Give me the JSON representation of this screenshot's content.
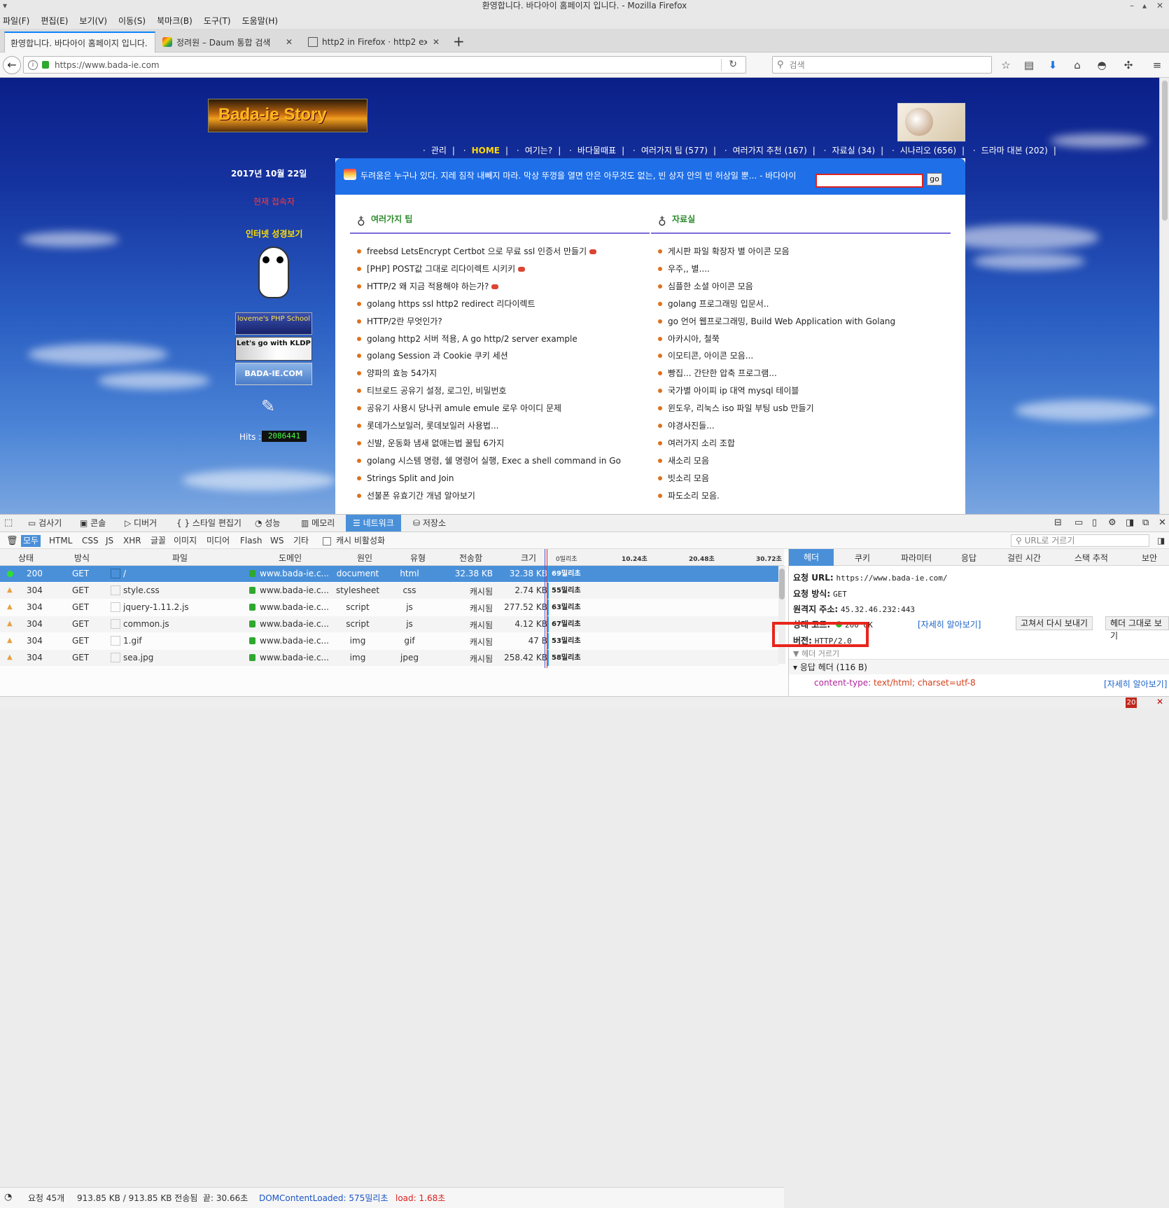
{
  "window": {
    "title": "환영합니다. 바다아이 홈페이지 입니다. - Mozilla Firefox"
  },
  "menu": [
    "파일(F)",
    "편집(E)",
    "보기(V)",
    "이동(S)",
    "북마크(B)",
    "도구(T)",
    "도움말(H)"
  ],
  "tabs": [
    {
      "label": "환영합니다. 바다아이 홈페이지 입니다.",
      "active": true
    },
    {
      "label": "정려원 – Daum 통합 검색",
      "active": false
    },
    {
      "label": "http2 in Firefox · http2 explained",
      "active": false
    }
  ],
  "nav": {
    "url": "https://www.bada-ie.com",
    "search_placeholder": "검색"
  },
  "site": {
    "logo_text": "Bada-ie Story",
    "links": [
      "관리",
      "HOME",
      "여기는?",
      "바다물때표",
      "여러가지 팁 (577)",
      "여러가지 추천 (167)",
      "자료실 (34)",
      "시나리오 (656)",
      "드라마 대본 (202)"
    ],
    "date": "2017년 10월 22일",
    "visitors_label": "현재 접속자",
    "bible_label": "인터넷 성경보기",
    "badges": [
      "loveme's PHP School",
      "Let's go with KLDP",
      "BADA-IE.COM"
    ],
    "hits_label": "Hits :",
    "hits_value": "2086441",
    "quote": "두려움은 누구나 있다. 지레 짐작 내빼지 마라. 막상 뚜껑을 열면 안은 아무것도 없는, 빈 상자 안의 빈 허상일 뿐... - 바다아이",
    "search_button": "go",
    "section1_title": "여러가지 팁",
    "section2_title": "자료실",
    "tips": [
      {
        "text": "freebsd LetsEncrypt Certbot 으로 무료 ssl 인증서 만들기",
        "new": true
      },
      {
        "text": "[PHP] POST값 그대로 리다이렉트 시키키",
        "new": true
      },
      {
        "text": "HTTP/2 왜 지금 적용해야 하는가?",
        "new": true
      },
      {
        "text": "golang https ssl http2 redirect 리다이렉트",
        "new": false
      },
      {
        "text": "HTTP/2란 무엇인가?",
        "new": false
      },
      {
        "text": "golang http2 서버 적용, A go http/2 server example",
        "new": false
      },
      {
        "text": "golang Session 과 Cookie 쿠키 세션",
        "new": false
      },
      {
        "text": "양파의 효능 54가지",
        "new": false
      },
      {
        "text": "티브로드 공유기 설정, 로그인, 비밀번호",
        "new": false
      },
      {
        "text": "공유기 사용시 당나귀 amule emule 로우 아이디 문제",
        "new": false
      },
      {
        "text": "롯데가스보일러, 롯데보일러 사용법...",
        "new": false
      },
      {
        "text": "신발, 운동화 냄새 없애는법 꿀팁 6가지",
        "new": false
      },
      {
        "text": "golang 시스템 명령, 쉘 명령어 실행, Exec a shell command in Go",
        "new": false
      },
      {
        "text": "Strings Split and Join",
        "new": false
      },
      {
        "text": "선불폰 유효기간 개념 알아보기",
        "new": false
      }
    ],
    "files": [
      "게시판 파일 확장자 별 아이콘 모음",
      "우주,, 별....",
      "심플한 소셜 아이콘 모음",
      "golang 프로그래밍 입문서..",
      "go 언어 웹프로그래밍, Build Web Application with Golang",
      "아카시아, 철쭉",
      "이모티콘, 아이콘 모음...",
      "빵집... 간단한 압축 프로그램...",
      "국가별 아이피 ip 대역 mysql 테이블",
      "윈도우, 리눅스 iso 파일 부팅 usb 만들기",
      "야경사진들...",
      "여러가지 소리 조합",
      "새소리 모음",
      "빗소리 모음",
      "파도소리 모음."
    ]
  },
  "devtools": {
    "tools": [
      "검사기",
      "콘솔",
      "디버거",
      "스타일 편집기",
      "성능",
      "메모리",
      "네트워크",
      "저장소"
    ],
    "filters": [
      "모두",
      "HTML",
      "CSS",
      "JS",
      "XHR",
      "글꼴",
      "이미지",
      "미디어",
      "Flash",
      "WS",
      "기타"
    ],
    "cache_label": "캐시 비활성화",
    "url_filter_placeholder": "URL로 거르기",
    "columns": [
      "상태",
      "방식",
      "파일",
      "도메인",
      "원인",
      "유형",
      "전송함",
      "크기"
    ],
    "timeline_ticks": [
      "0밀리초",
      "10.24초",
      "20.48초",
      "30.72초"
    ],
    "requests": [
      {
        "status": "200",
        "method": "GET",
        "file": "/",
        "domain": "www.bada-ie.c...",
        "cause": "document",
        "type": "html",
        "transferred": "32.38 KB",
        "size": "32.38 KB",
        "time": "69밀리초",
        "selected": true
      },
      {
        "status": "304",
        "method": "GET",
        "file": "style.css",
        "domain": "www.bada-ie.c...",
        "cause": "stylesheet",
        "type": "css",
        "transferred": "캐시됨",
        "size": "2.74 KB",
        "time": "55밀리초"
      },
      {
        "status": "304",
        "method": "GET",
        "file": "jquery-1.11.2.js",
        "domain": "www.bada-ie.c...",
        "cause": "script",
        "type": "js",
        "transferred": "캐시됨",
        "size": "277.52 KB",
        "time": "63밀리초"
      },
      {
        "status": "304",
        "method": "GET",
        "file": "common.js",
        "domain": "www.bada-ie.c...",
        "cause": "script",
        "type": "js",
        "transferred": "캐시됨",
        "size": "4.12 KB",
        "time": "67밀리초"
      },
      {
        "status": "304",
        "method": "GET",
        "file": "1.gif",
        "domain": "www.bada-ie.c...",
        "cause": "img",
        "type": "gif",
        "transferred": "캐시됨",
        "size": "47 B",
        "time": "53밀리초"
      },
      {
        "status": "304",
        "method": "GET",
        "file": "sea.jpg",
        "domain": "www.bada-ie.c...",
        "cause": "img",
        "type": "jpeg",
        "transferred": "캐시됨",
        "size": "258.42 KB",
        "time": "58밀리초"
      }
    ],
    "detail_tabs": [
      "헤더",
      "쿠키",
      "파라미터",
      "응답",
      "걸린 시간",
      "스택 추적",
      "보안"
    ],
    "request_url_label": "요청 URL:",
    "request_url": "https://www.bada-ie.com/",
    "method_label": "요청 방식:",
    "method": "GET",
    "remote_label": "원격지 주소:",
    "remote": "45.32.46.232:443",
    "status_label": "상태 코드:",
    "status": "200 OK",
    "learn_more": "[자세히 알아보기]",
    "resend": "고쳐서 다시 보내기",
    "raw_headers": "헤더 그대로 보기",
    "version_label": "버전:",
    "version": "HTTP/2.0",
    "filter_headers": "헤더 거르기",
    "response_headers": "응답 헤더 (116 B)",
    "content_type_key": "content-type:",
    "content_type_val": "text/html; charset=utf-8",
    "summary": {
      "requests": "요청 45개",
      "transfer": "913.85 KB / 913.85 KB 전송됨",
      "finish": "끝: 30.66초",
      "dcl": "DOMContentLoaded: 575밀리초",
      "load": "load: 1.68초"
    }
  },
  "colors": {
    "accent": "#4a90d9",
    "highlight_box": "#e8251c",
    "page_bg": "#15339f",
    "quote_bar": "#1e6fe8"
  },
  "badge_count": "20"
}
